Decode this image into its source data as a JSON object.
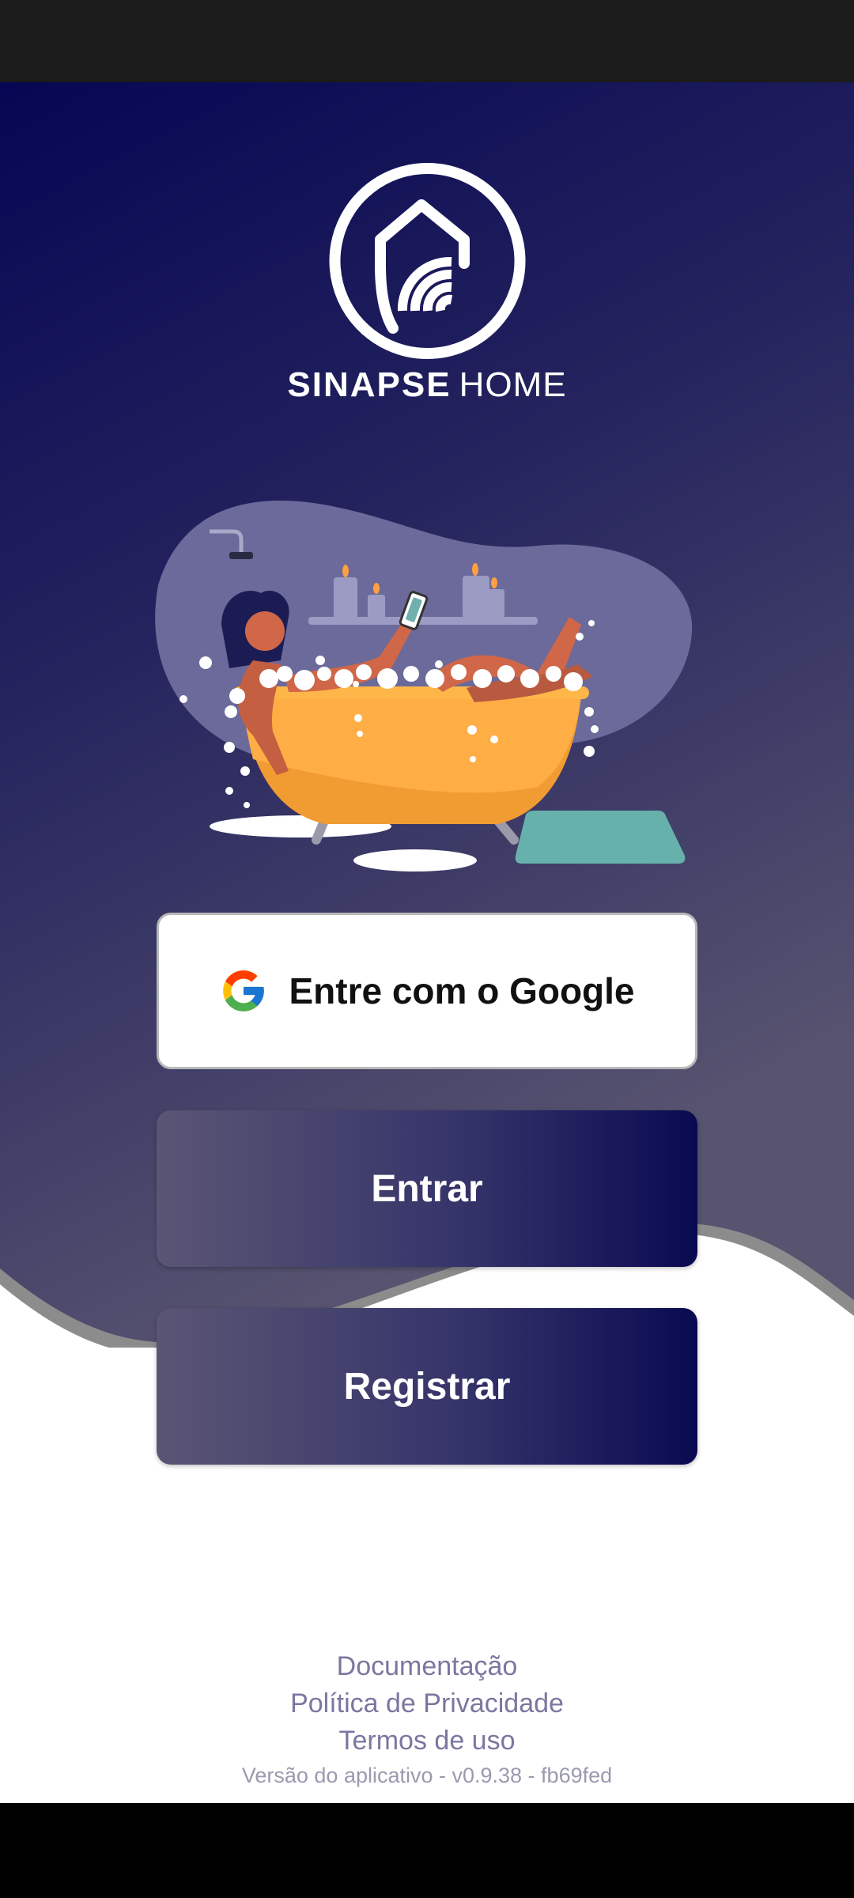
{
  "brand": {
    "name_bold": "SINAPSE",
    "name_light": "HOME"
  },
  "auth": {
    "google_label": "Entre com o Google",
    "login_label": "Entrar",
    "register_label": "Registrar"
  },
  "footer": {
    "docs": "Documentação",
    "privacy": "Política de Privacidade",
    "terms": "Termos de uso",
    "version": "Versão do aplicativo - v0.9.38 - fb69fed"
  },
  "colors": {
    "background_top": "#060654",
    "background_bottom": "#585470",
    "button_gradient_start": "#5a5574",
    "button_gradient_end": "#0a0a52",
    "footer_link": "#7a77a0"
  },
  "icons": {
    "logo": "house-wifi-icon",
    "google": "google-g-icon"
  }
}
